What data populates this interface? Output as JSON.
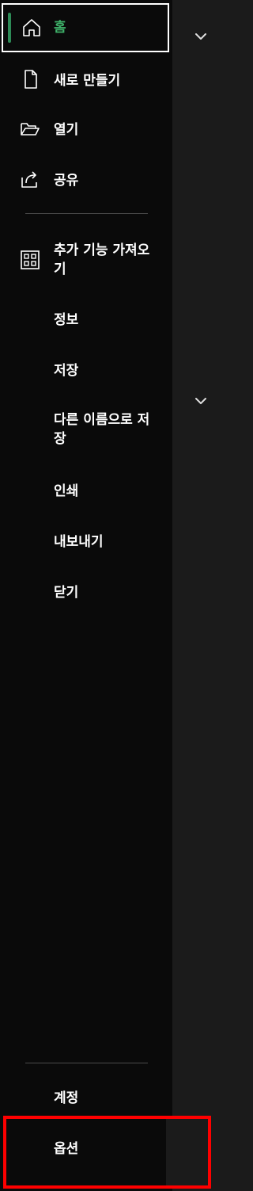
{
  "nav": {
    "home": "홈",
    "new": "새로 만들기",
    "open": "열기",
    "share": "공유",
    "get_addins": "추가 기능 가져오기",
    "info": "정보",
    "save": "저장",
    "save_as": "다른 이름으로 저장",
    "print": "인쇄",
    "export": "내보내기",
    "close": "닫기",
    "account": "계정",
    "options": "옵션"
  },
  "colors": {
    "sidebar_bg": "#0a0a0a",
    "panel_bg": "#1b1b1b",
    "accent": "#3fb26a",
    "highlight": "#ff0000"
  },
  "icons": {
    "home": "home-icon",
    "new": "new-document-icon",
    "open": "open-folder-icon",
    "share": "share-icon",
    "get_addins": "addins-grid-icon",
    "chevron": "chevron-down-icon"
  }
}
